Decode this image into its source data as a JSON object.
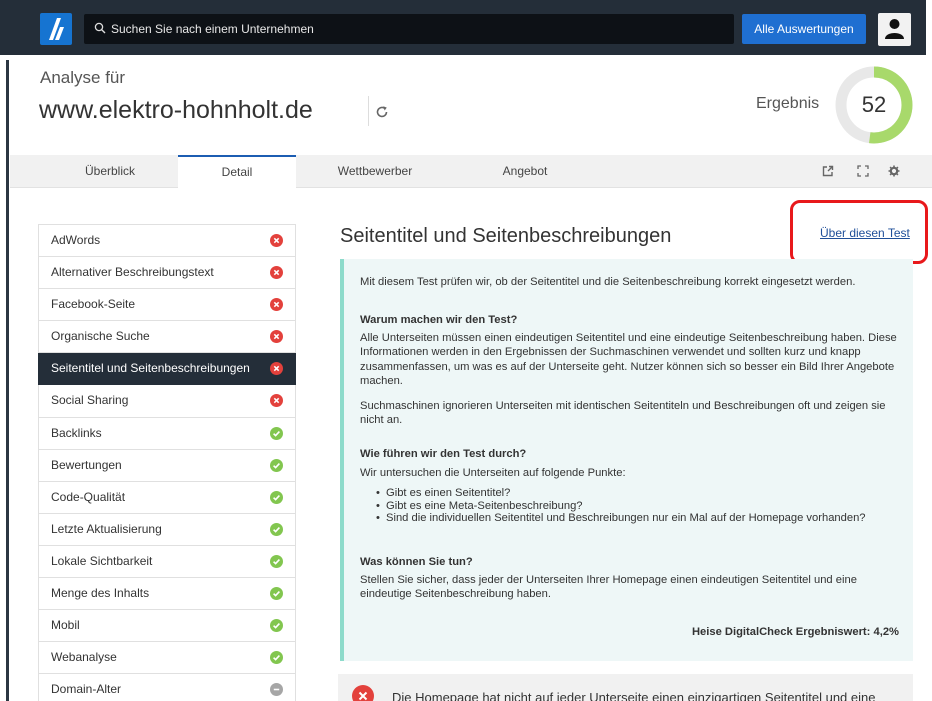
{
  "topbar": {
    "search_placeholder": "Suchen Sie nach einem Unternehmen",
    "all_reports_label": "Alle Auswertungen"
  },
  "header": {
    "analyse_label": "Analyse für",
    "domain": "www.elektro-hohnholt.de",
    "result_label": "Ergebnis",
    "score": "52",
    "score_fraction": 0.52,
    "score_color": "#a8d96b"
  },
  "tabs": [
    {
      "label": "Überblick"
    },
    {
      "label": "Detail"
    },
    {
      "label": "Wettbewerber"
    },
    {
      "label": "Angebot"
    }
  ],
  "sidebar": {
    "items": [
      {
        "label": "AdWords",
        "status": "fail"
      },
      {
        "label": "Alternativer Beschreibungstext",
        "status": "fail"
      },
      {
        "label": "Facebook-Seite",
        "status": "fail"
      },
      {
        "label": "Organische Suche",
        "status": "fail"
      },
      {
        "label": "Seitentitel und Seitenbeschreibungen",
        "status": "fail"
      },
      {
        "label": "Social Sharing",
        "status": "fail"
      },
      {
        "label": "Backlinks",
        "status": "ok"
      },
      {
        "label": "Bewertungen",
        "status": "ok"
      },
      {
        "label": "Code-Qualität",
        "status": "ok"
      },
      {
        "label": "Letzte Aktualisierung",
        "status": "ok"
      },
      {
        "label": "Lokale Sichtbarkeit",
        "status": "ok"
      },
      {
        "label": "Menge des Inhalts",
        "status": "ok"
      },
      {
        "label": "Mobil",
        "status": "ok"
      },
      {
        "label": "Webanalyse",
        "status": "ok"
      },
      {
        "label": "Domain-Alter",
        "status": "neutral"
      }
    ]
  },
  "main": {
    "title": "Seitentitel und Seitenbeschreibungen",
    "about_link": "Über diesen Test",
    "intro": "Mit diesem Test prüfen wir, ob der Seitentitel und die Seitenbeschreibung korrekt eingesetzt werden.",
    "why_heading": "Warum machen wir den Test?",
    "why_text": "Alle Unterseiten müssen einen eindeutigen Seitentitel und eine eindeutige Seitenbeschreibung haben. Diese Informationen werden in den Ergebnissen der Suchmaschinen verwendet und sollten kurz und knapp zusammenfassen, um was es auf der Unterseite geht. Nutzer können sich so besser ein Bild Ihrer Angebote machen.",
    "why_text2": "Suchmaschinen ignorieren Unterseiten mit identischen Seitentiteln und Beschreibungen oft und zeigen sie nicht an.",
    "how_heading": "Wie führen wir den Test durch?",
    "how_text": "Wir untersuchen die Unterseiten auf folgende Punkte:",
    "how_points": [
      "Gibt es einen Seitentitel?",
      "Gibt es eine Meta-Seitenbeschreibung?",
      "Sind die individuellen Seitentitel und Beschreibungen nur ein Mal auf der Homepage vorhanden?"
    ],
    "what_heading": "Was können Sie tun?",
    "what_text": "Stellen Sie sicher, dass jeder der Unterseiten Ihrer Homepage einen eindeutigen Seitentitel und eine eindeutige Seitenbeschreibung haben.",
    "score_text": "Heise DigitalCheck Ergebniswert: 4,2%",
    "result_text": "Die Homepage hat nicht auf jeder Unterseite einen einzigartigen Seitentitel und eine"
  }
}
